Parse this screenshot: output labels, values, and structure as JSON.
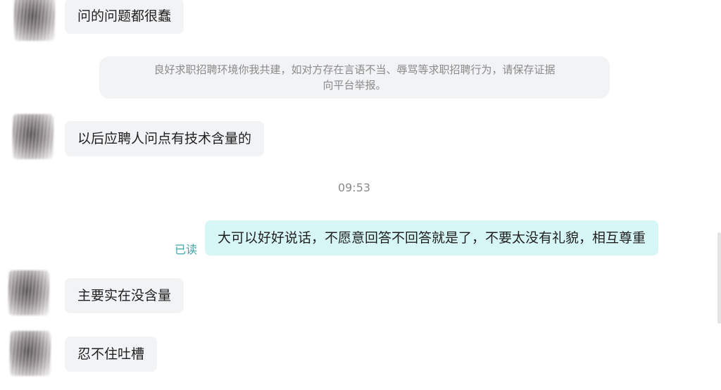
{
  "messages": {
    "m1": "问的问题都很蠢",
    "m2": "以后应聘人问点有技术含量的",
    "m3": "大可以好好说话，不愿意回答不回答就是了，不要太没有礼貌，相互尊重",
    "m4": "主要实在没含量",
    "m5": "忍不住吐槽"
  },
  "notice": {
    "line1": "良好求职招聘环境你我共建，如对方存在言语不当、辱骂等求职招聘行为，请保存证据",
    "line2": "向平台举报。"
  },
  "timestamp": "09:53",
  "read_status": "已读"
}
